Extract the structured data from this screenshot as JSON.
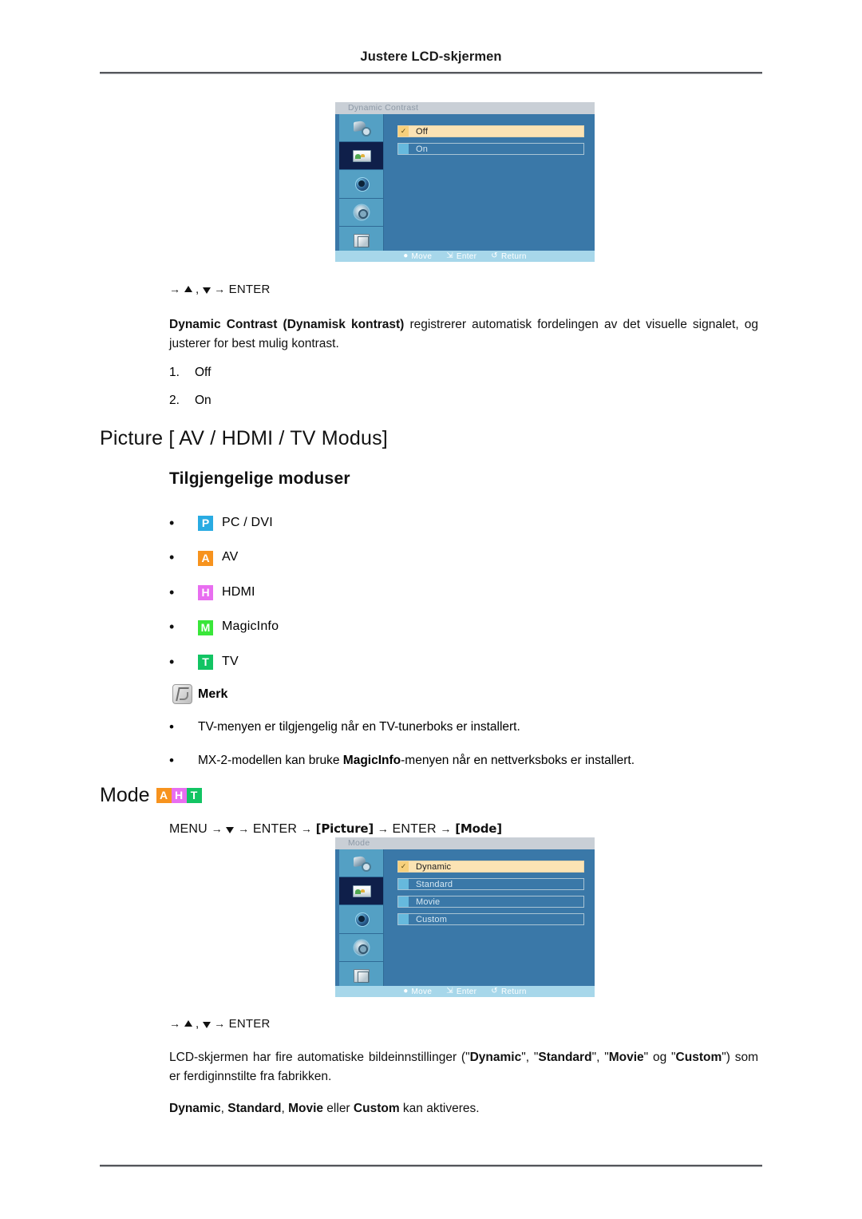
{
  "header": {
    "running_title": "Justere LCD-skjermen"
  },
  "osd_dynamic_contrast": {
    "title": "Dynamic Contrast",
    "sidebar_icons": [
      "input-icon",
      "picture-icon",
      "sound-icon",
      "setup-icon",
      "multi-control-icon"
    ],
    "selected_sidebar_index": 1,
    "options": [
      {
        "label": "Off",
        "selected": true
      },
      {
        "label": "On",
        "selected": false
      }
    ],
    "footer": [
      {
        "icon": "move-icon",
        "label": "Move"
      },
      {
        "icon": "enter-icon",
        "label": "Enter"
      },
      {
        "icon": "return-icon",
        "label": "Return"
      }
    ],
    "colors": {
      "panel": "#3a78a8",
      "titlebar": "#c9cfd6",
      "sidebar": "#54a0c4",
      "sidebar_selected": "#0f1f4a",
      "highlight": "#fbe3b4",
      "footer": "#a7d7ea"
    }
  },
  "nav_path_1": {
    "text": "→ ▲ , ▼ → ENTER"
  },
  "dynamic_contrast_desc": {
    "bold_lead": "Dynamic Contrast (Dynamisk kontrast)",
    "rest": " registrerer automatisk fordelingen av det visuelle signalet, og justerer for best mulig kontrast."
  },
  "dynamic_contrast_list": [
    {
      "num": "1.",
      "label": "Off"
    },
    {
      "num": "2.",
      "label": "On"
    }
  ],
  "picture_section": {
    "heading": "Picture [ AV / HDMI / TV Modus]",
    "subheading": "Tilgjengelige moduser",
    "modes": [
      {
        "badge": "P",
        "badge_color": "#29abe2",
        "label": "PC / DVI"
      },
      {
        "badge": "A",
        "badge_color": "#f7931e",
        "label": "AV"
      },
      {
        "badge": "H",
        "badge_color": "#e86ef0",
        "label": "HDMI"
      },
      {
        "badge": "M",
        "badge_color": "#39e639",
        "label": "MagicInfo"
      },
      {
        "badge": "T",
        "badge_color": "#12c463",
        "label": "TV"
      }
    ],
    "note_title": "Merk",
    "notes": [
      {
        "pre": "TV-menyen er tilgjengelig når en TV-tunerboks er installert.",
        "bold": "",
        "post": ""
      },
      {
        "pre": "MX-2-modellen kan bruke ",
        "bold": "MagicInfo",
        "post": "-menyen når en nettverksboks er installert."
      }
    ]
  },
  "mode_section": {
    "heading": "Mode",
    "badges": [
      {
        "badge": "A",
        "badge_color": "#f7931e"
      },
      {
        "badge": "H",
        "badge_color": "#e86ef0"
      },
      {
        "badge": "T",
        "badge_color": "#12c463"
      }
    ],
    "menu_path_parts": [
      {
        "type": "plain",
        "text": "MENU → "
      },
      {
        "type": "tri-down",
        "text": ""
      },
      {
        "type": "plain",
        "text": " → ENTER → "
      },
      {
        "type": "key",
        "text": "[Picture]"
      },
      {
        "type": "plain",
        "text": " → ENTER → "
      },
      {
        "type": "key",
        "text": "[Mode]"
      }
    ],
    "menu_path_plain": "MENU → ▼ → ENTER → [Picture] → ENTER → [Mode]"
  },
  "osd_mode": {
    "title": "Mode",
    "sidebar_icons": [
      "input-icon",
      "picture-icon",
      "sound-icon",
      "setup-icon",
      "multi-control-icon"
    ],
    "selected_sidebar_index": 1,
    "options": [
      {
        "label": "Dynamic",
        "selected": true
      },
      {
        "label": "Standard",
        "selected": false
      },
      {
        "label": "Movie",
        "selected": false
      },
      {
        "label": "Custom",
        "selected": false
      }
    ],
    "footer": [
      {
        "icon": "move-icon",
        "label": "Move"
      },
      {
        "icon": "enter-icon",
        "label": "Enter"
      },
      {
        "icon": "return-icon",
        "label": "Return"
      }
    ]
  },
  "nav_path_2": {
    "text": "→ ▲ , ▼ → ENTER"
  },
  "mode_desc": {
    "line1_a": "LCD-skjermen har fire automatiske bildeinnstillinger (\"",
    "b1": "Dynamic",
    "line1_b": "\", \"",
    "b2": "Standard",
    "line1_c": "\", \"",
    "b3": "Movie",
    "line1_d": "\" og \"",
    "b4": "Custom",
    "line1_e": "\") som er ferdiginnstilte fra fabrikken.",
    "line2_b1": "Dynamic",
    "line2_s1": ", ",
    "line2_b2": "Standard",
    "line2_s2": ", ",
    "line2_b3": "Movie",
    "line2_s3": " eller ",
    "line2_b4": "Custom",
    "line2_s4": " kan aktiveres."
  }
}
